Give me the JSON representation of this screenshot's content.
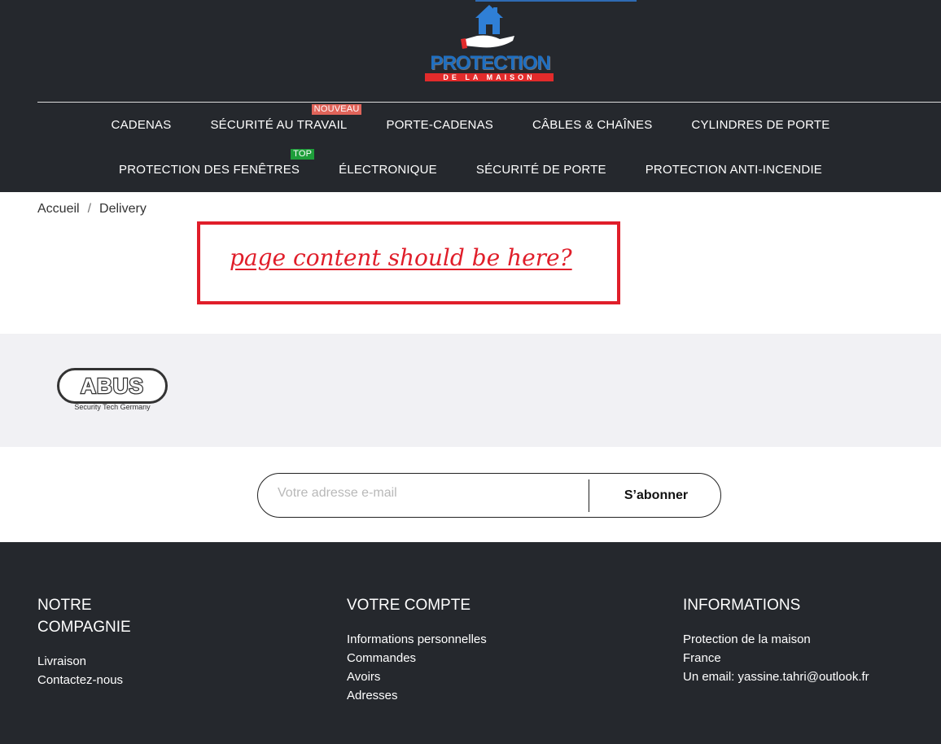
{
  "header": {
    "logo": {
      "word": "PROTECTION",
      "sub": "DE LA MAISON"
    },
    "nav_row1": [
      {
        "label": "CADENAS"
      },
      {
        "label": "SÉCURITÉ AU TRAVAIL",
        "badge": "NOUVEAU"
      },
      {
        "label": "PORTE-CADENAS"
      },
      {
        "label": "CÂBLES & CHAÎNES"
      },
      {
        "label": "CYLINDRES DE PORTE"
      }
    ],
    "nav_row2": [
      {
        "label": "PROTECTION DES FENÊTRES",
        "badge": "TOP"
      },
      {
        "label": "ÉLECTRONIQUE"
      },
      {
        "label": "SÉCURITÉ DE PORTE"
      },
      {
        "label": "PROTECTION ANTI-INCENDIE"
      }
    ]
  },
  "breadcrumb": {
    "home": "Accueil",
    "separator": "/",
    "current": "Delivery"
  },
  "annotation": {
    "text": "page content should be here?",
    "color": "#e01e2a"
  },
  "brands": {
    "abus": {
      "name": "ABUS",
      "tagline": "Security Tech Germany"
    }
  },
  "newsletter": {
    "placeholder": "Votre adresse e-mail",
    "button": "S’abonner"
  },
  "footer": {
    "company": {
      "title": "NOTRE COMPAGNIE",
      "links": [
        "Livraison",
        "Contactez-nous"
      ]
    },
    "account": {
      "title": "VOTRE COMPTE",
      "links": [
        "Informations personnelles",
        "Commandes",
        "Avoirs",
        "Adresses"
      ]
    },
    "info": {
      "title": "INFORMATIONS",
      "lines": [
        "Protection de la maison",
        "France",
        "Un email: yassine.tahri@outlook.fr"
      ]
    }
  },
  "colors": {
    "header_bg": "#25282d",
    "badge_new": "#e0645a",
    "badge_top": "#1e9e3a",
    "brand_blue": "#1f6fc1",
    "brand_red": "#e22b2b"
  }
}
